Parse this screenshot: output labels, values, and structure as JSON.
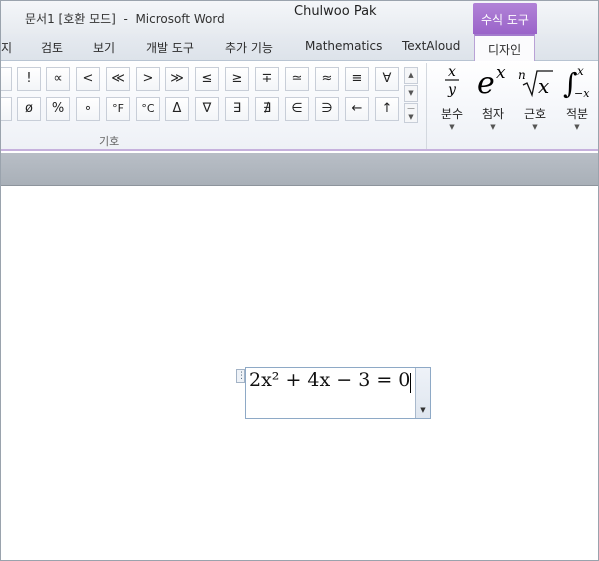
{
  "window": {
    "title": "문서1 [호환 모드]  -  Microsoft Word",
    "user": "Chulwoo Pak",
    "context_group": "수식 도구"
  },
  "tabs": [
    {
      "label": "지"
    },
    {
      "label": "검토"
    },
    {
      "label": "보기"
    },
    {
      "label": "개발 도구"
    },
    {
      "label": "추가 기능"
    },
    {
      "label": "Mathematics"
    },
    {
      "label": "TextAloud"
    },
    {
      "label": "디자인",
      "active": true
    }
  ],
  "symbols": {
    "row1": [
      "|",
      "!",
      "∝",
      "<",
      "≪",
      ">",
      "≫",
      "≤",
      "≥",
      "∓",
      "≃",
      "≈",
      "≡",
      "∀"
    ],
    "row2": [
      "",
      "ø",
      "%",
      "∘",
      "°F",
      "°C",
      "Δ",
      "∇",
      "∃",
      "∄",
      "∈",
      "∋",
      "←",
      "↑"
    ],
    "group_label": "기호"
  },
  "structures": [
    {
      "label": "분수",
      "icon": "fraction-icon"
    },
    {
      "label": "첨자",
      "icon": "script-icon"
    },
    {
      "label": "근호",
      "icon": "radical-icon"
    },
    {
      "label": "적분",
      "icon": "integral-icon"
    }
  ],
  "equation": {
    "text": "2x² + 4x − 3 = 0"
  },
  "colors": {
    "accent": "#9a63c9",
    "border": "#8ea9c6"
  }
}
